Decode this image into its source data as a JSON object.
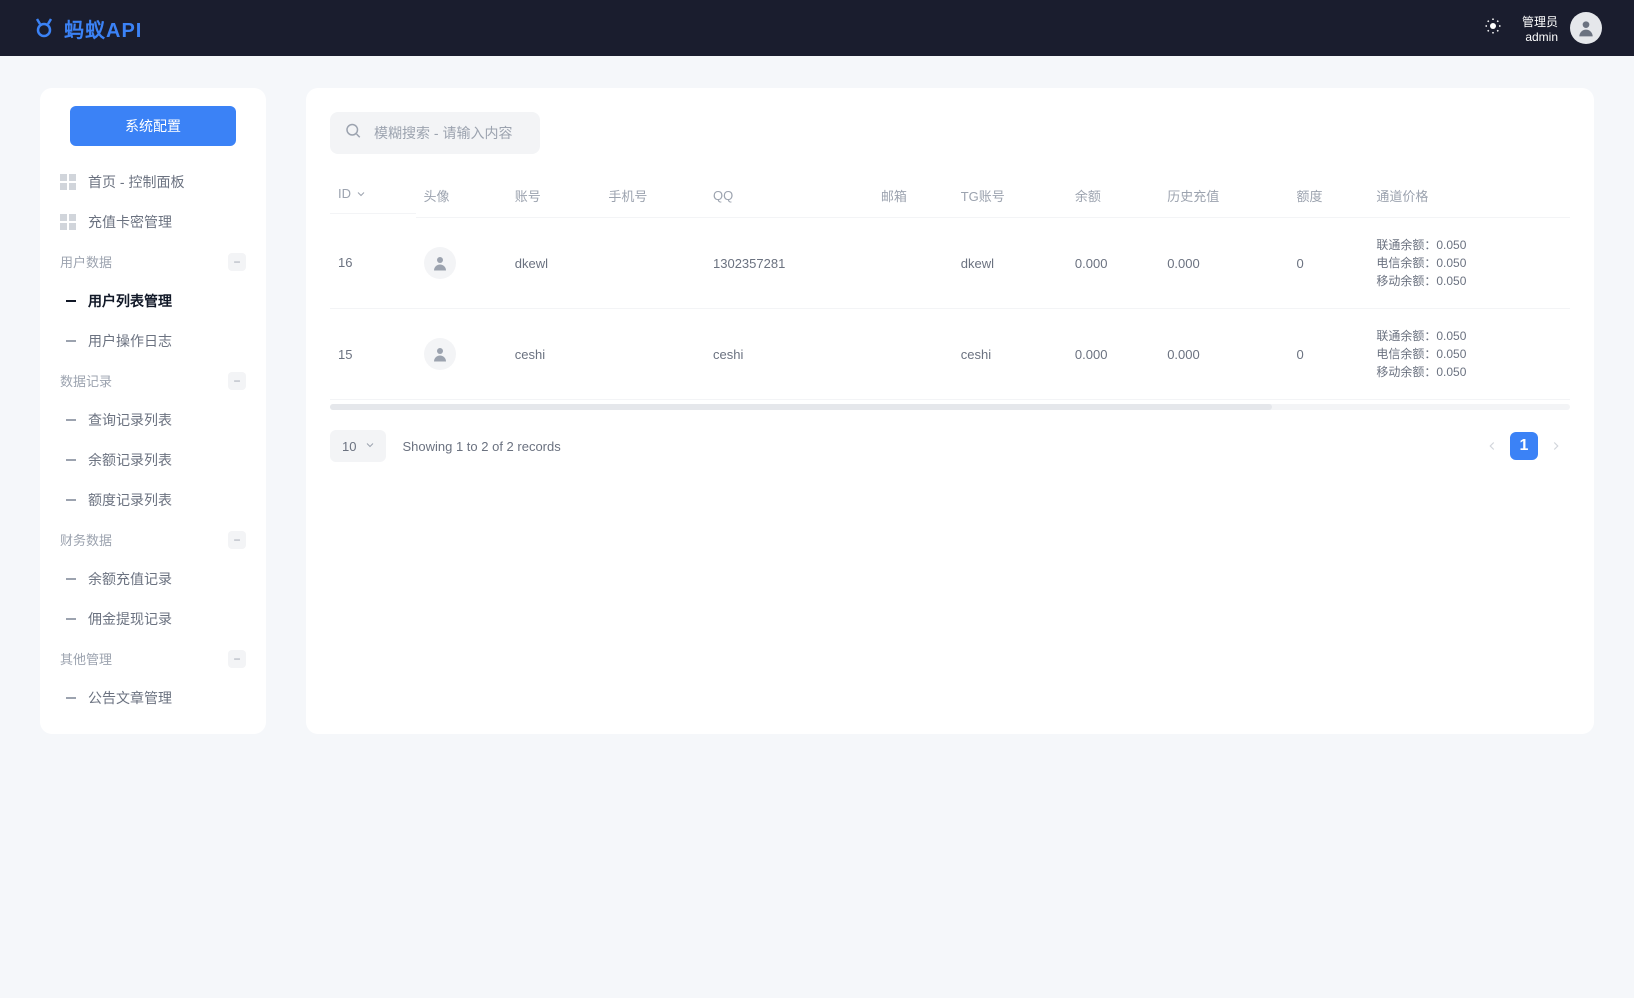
{
  "header": {
    "logo_text": "蚂蚁API",
    "user_role": "管理员",
    "user_name": "admin"
  },
  "sidebar": {
    "config_button": "系统配置",
    "nav": [
      {
        "label": "首页 - 控制面板",
        "type": "item"
      },
      {
        "label": "充值卡密管理",
        "type": "item"
      }
    ],
    "groups": [
      {
        "label": "用户数据",
        "items": [
          {
            "label": "用户列表管理",
            "active": true
          },
          {
            "label": "用户操作日志"
          }
        ]
      },
      {
        "label": "数据记录",
        "items": [
          {
            "label": "查询记录列表"
          },
          {
            "label": "余额记录列表"
          },
          {
            "label": "额度记录列表"
          }
        ]
      },
      {
        "label": "财务数据",
        "items": [
          {
            "label": "余额充值记录"
          },
          {
            "label": "佣金提现记录"
          }
        ]
      },
      {
        "label": "其他管理",
        "items": [
          {
            "label": "公告文章管理"
          }
        ]
      }
    ]
  },
  "main": {
    "search_placeholder": "模糊搜索 - 请输入内容",
    "columns": [
      "ID",
      "头像",
      "账号",
      "手机号",
      "QQ",
      "邮箱",
      "TG账号",
      "余额",
      "历史充值",
      "额度",
      "通道价格"
    ],
    "rows": [
      {
        "id": "16",
        "account": "dkewl",
        "phone": "",
        "qq": "1302357281",
        "email": "",
        "tg": "dkewl",
        "balance": "0.000",
        "history": "0.000",
        "quota": "0",
        "prices": [
          "联通余额：0.050",
          "电信余额：0.050",
          "移动余额：0.050"
        ]
      },
      {
        "id": "15",
        "account": "ceshi",
        "phone": "",
        "qq": "ceshi",
        "email": "",
        "tg": "ceshi",
        "balance": "0.000",
        "history": "0.000",
        "quota": "0",
        "prices": [
          "联通余额：0.050",
          "电信余额：0.050",
          "移动余额：0.050"
        ]
      }
    ],
    "page_size": "10",
    "records_text": "Showing 1 to 2 of 2 records",
    "current_page": "1"
  }
}
